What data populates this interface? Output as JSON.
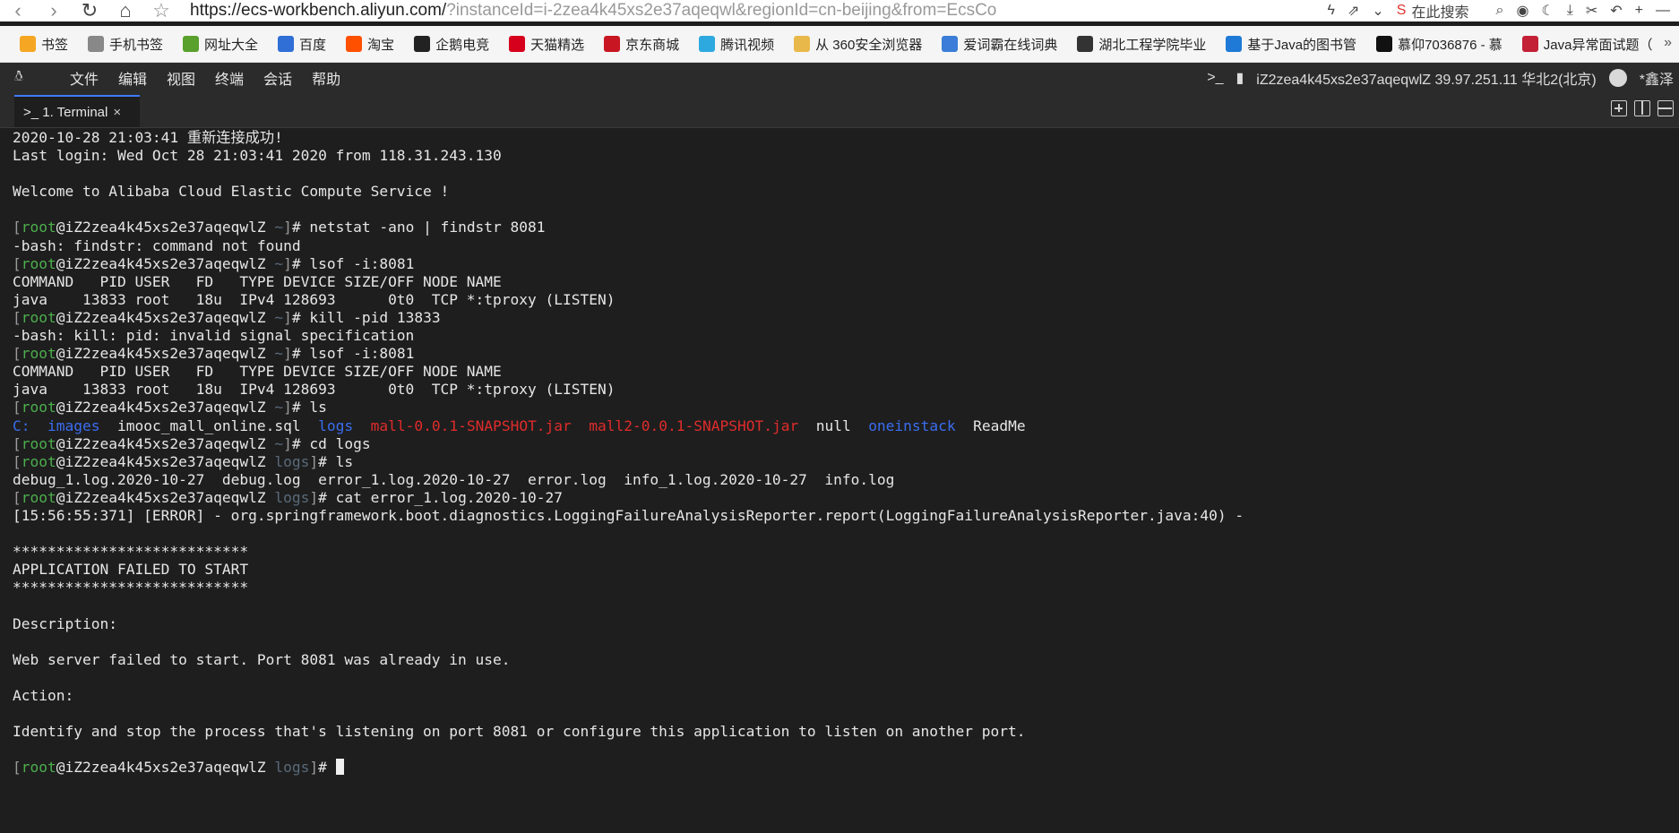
{
  "browser": {
    "url_main": "https://ecs-workbench.aliyun.com/",
    "url_rest": "?instanceId=i-2zea4k45xs2e37aqeqwl&regionId=cn-beijing&from=EcsCo",
    "search_placeholder": "在此搜索"
  },
  "bookmarks": [
    {
      "label": "书签",
      "icon": "star-icon",
      "color": "#f5a623"
    },
    {
      "label": "手机书签",
      "icon": "phone-icon",
      "color": "#888888"
    },
    {
      "label": "网址大全",
      "icon": "hao-icon",
      "color": "#5aa02c"
    },
    {
      "label": "百度",
      "icon": "baidu-icon",
      "color": "#2f6fd6"
    },
    {
      "label": "淘宝",
      "icon": "taobao-icon",
      "color": "#ff5000"
    },
    {
      "label": "企鹅电竞",
      "icon": "penguin-icon",
      "color": "#222222"
    },
    {
      "label": "天猫精选",
      "icon": "tmall-icon",
      "color": "#d6001c"
    },
    {
      "label": "京东商城",
      "icon": "jd-icon",
      "color": "#c81623"
    },
    {
      "label": "腾讯视频",
      "icon": "tencent-video-icon",
      "color": "#2ea9df"
    },
    {
      "label": "从 360安全浏览器",
      "icon": "folder-icon",
      "color": "#e8b84a"
    },
    {
      "label": "爱词霸在线词典",
      "icon": "iciba-icon",
      "color": "#3b7dd8"
    },
    {
      "label": "湖北工程学院毕业",
      "icon": "graduation-icon",
      "color": "#333333"
    },
    {
      "label": "基于Java的图书管",
      "icon": "ie-icon",
      "color": "#1e7ad6"
    },
    {
      "label": "慕仰7036876 - 慕",
      "icon": "imooc-icon",
      "color": "#111111"
    },
    {
      "label": "Java异常面试题（",
      "icon": "csdn-icon",
      "color": "#c32136"
    }
  ],
  "menubar": {
    "items": [
      "文件",
      "编辑",
      "视图",
      "终端",
      "会话",
      "帮助"
    ],
    "instance": "iZ2zea4k45xs2e37aqeqwlZ 39.97.251.11 华北2(北京)",
    "user": "*鑫泽"
  },
  "tab": {
    "label": ">_ 1. Terminal",
    "close": "×"
  },
  "terminal": {
    "user": "root",
    "host": "@iZ2zea4k45xs2e37aqeqwlZ",
    "lines": [
      {
        "type": "text",
        "text": "2020-10-28 21:03:41 重新连接成功!"
      },
      {
        "type": "text",
        "text": "Last login: Wed Oct 28 21:03:41 2020 from 118.31.243.130"
      },
      {
        "type": "text",
        "text": ""
      },
      {
        "type": "text",
        "text": "Welcome to Alibaba Cloud Elastic Compute Service !"
      },
      {
        "type": "text",
        "text": ""
      },
      {
        "type": "prompt",
        "dir": "~",
        "cmd": "netstat -ano | findstr 8081"
      },
      {
        "type": "text",
        "text": "-bash: findstr: command not found"
      },
      {
        "type": "prompt",
        "dir": "~",
        "cmd": "lsof -i:8081"
      },
      {
        "type": "text",
        "text": "COMMAND   PID USER   FD   TYPE DEVICE SIZE/OFF NODE NAME"
      },
      {
        "type": "text",
        "text": "java    13833 root   18u  IPv4 128693      0t0  TCP *:tproxy (LISTEN)"
      },
      {
        "type": "prompt",
        "dir": "~",
        "cmd": "kill -pid 13833"
      },
      {
        "type": "text",
        "text": "-bash: kill: pid: invalid signal specification"
      },
      {
        "type": "prompt",
        "dir": "~",
        "cmd": "lsof -i:8081"
      },
      {
        "type": "text",
        "text": "COMMAND   PID USER   FD   TYPE DEVICE SIZE/OFF NODE NAME"
      },
      {
        "type": "text",
        "text": "java    13833 root   18u  IPv4 128693      0t0  TCP *:tproxy (LISTEN)"
      },
      {
        "type": "prompt",
        "dir": "~",
        "cmd": "ls"
      },
      {
        "type": "ls",
        "items": [
          {
            "text": "C:",
            "kind": "dir"
          },
          {
            "text": "images",
            "kind": "dir"
          },
          {
            "text": "imooc_mall_online.sql",
            "kind": "file"
          },
          {
            "text": "logs",
            "kind": "dir"
          },
          {
            "text": "mall-0.0.1-SNAPSHOT.jar",
            "kind": "jar"
          },
          {
            "text": "mall2-0.0.1-SNAPSHOT.jar",
            "kind": "jar"
          },
          {
            "text": "null",
            "kind": "file"
          },
          {
            "text": "oneinstack",
            "kind": "dir"
          },
          {
            "text": "ReadMe",
            "kind": "file"
          }
        ]
      },
      {
        "type": "prompt",
        "dir": "~",
        "cmd": "cd logs"
      },
      {
        "type": "prompt",
        "dir": "logs",
        "cmd": "ls"
      },
      {
        "type": "text",
        "text": "debug_1.log.2020-10-27  debug.log  error_1.log.2020-10-27  error.log  info_1.log.2020-10-27  info.log"
      },
      {
        "type": "prompt",
        "dir": "logs",
        "cmd": "cat error_1.log.2020-10-27"
      },
      {
        "type": "text",
        "text": "[15:56:55:371] [ERROR] - org.springframework.boot.diagnostics.LoggingFailureAnalysisReporter.report(LoggingFailureAnalysisReporter.java:40) -"
      },
      {
        "type": "text",
        "text": ""
      },
      {
        "type": "text",
        "text": "***************************"
      },
      {
        "type": "text",
        "text": "APPLICATION FAILED TO START"
      },
      {
        "type": "text",
        "text": "***************************"
      },
      {
        "type": "text",
        "text": ""
      },
      {
        "type": "text",
        "text": "Description:"
      },
      {
        "type": "text",
        "text": ""
      },
      {
        "type": "text",
        "text": "Web server failed to start. Port 8081 was already in use."
      },
      {
        "type": "text",
        "text": ""
      },
      {
        "type": "text",
        "text": "Action:"
      },
      {
        "type": "text",
        "text": ""
      },
      {
        "type": "text",
        "text": "Identify and stop the process that's listening on port 8081 or configure this application to listen on another port."
      },
      {
        "type": "text",
        "text": ""
      },
      {
        "type": "prompt",
        "dir": "logs",
        "cmd": "",
        "cursor": true
      }
    ]
  }
}
